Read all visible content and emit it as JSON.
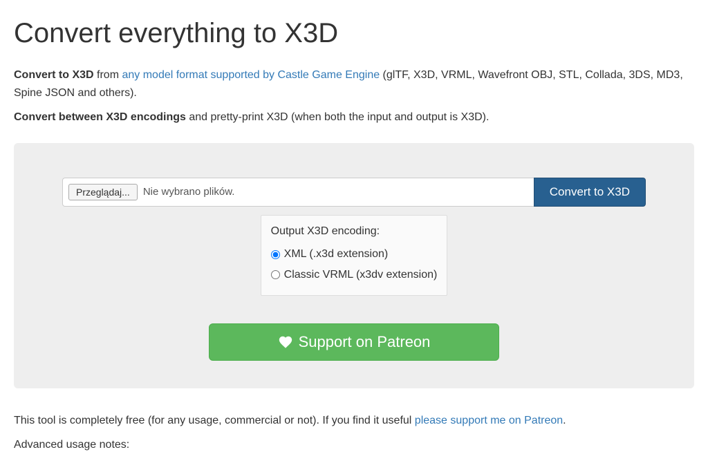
{
  "heading": "Convert everything to X3D",
  "intro1": {
    "strong": "Convert to X3D",
    "mid": " from ",
    "link": "any model format supported by Castle Game Engine",
    "tail": " (glTF, X3D, VRML, Wavefront OBJ, STL, Collada, 3DS, MD3, Spine JSON and others)."
  },
  "intro2": {
    "strong": "Convert between X3D encodings",
    "tail": " and pretty-print X3D (when both the input and output is X3D)."
  },
  "form": {
    "browse_label": "Przeglądaj...",
    "file_status": "Nie wybrano plików.",
    "convert_label": "Convert to X3D",
    "encoding_legend": "Output X3D encoding:",
    "option_xml": "XML (.x3d extension)",
    "option_classic": "Classic VRML (x3dv extension)",
    "patreon_label": "Support on Patreon"
  },
  "footer": {
    "free_prefix": "This tool is completely free (for any usage, commercial or not). If you find it useful ",
    "free_link": "please support me on Patreon",
    "free_suffix": ".",
    "advanced": "Advanced usage notes:"
  }
}
